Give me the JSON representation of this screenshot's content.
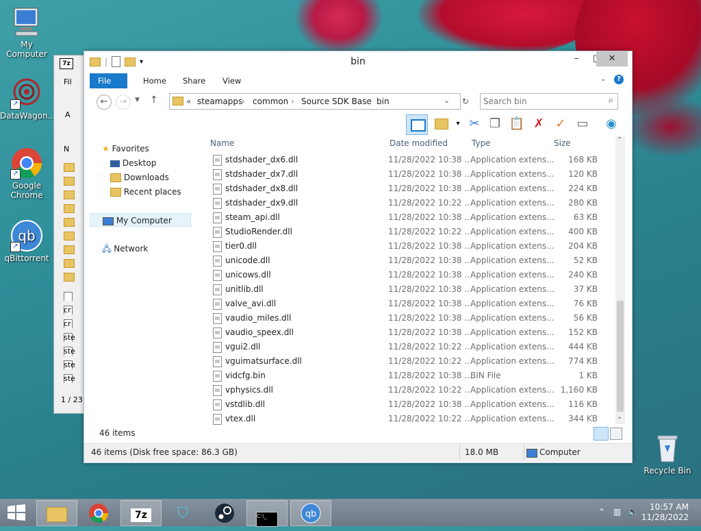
{
  "desktop": {
    "icons": [
      {
        "label": "My Computer"
      },
      {
        "label": "DataWagon..."
      },
      {
        "label": "Google Chrome"
      },
      {
        "label": "qBittorrent"
      },
      {
        "label": "Recycle Bin"
      }
    ]
  },
  "bg_window": {
    "labels": [
      "Fil",
      "A",
      "N"
    ],
    "rows": [
      "cr",
      "cr",
      "ste",
      "ste",
      "ste",
      "ste"
    ],
    "status": "1 / 23"
  },
  "explorer": {
    "title": "bin",
    "tabs": [
      "File",
      "Home",
      "Share",
      "View"
    ],
    "breadcrumb": {
      "overflow": "«",
      "parts": [
        "steamapps",
        "common",
        "Source SDK Base",
        "bin"
      ]
    },
    "search_placeholder": "Search bin",
    "nav": {
      "favorites": "Favorites",
      "fav_items": [
        "Desktop",
        "Downloads",
        "Recent places"
      ],
      "computer": "My Computer",
      "network": "Network"
    },
    "columns": {
      "name": "Name",
      "date": "Date modified",
      "type": "Type",
      "size": "Size"
    },
    "files": [
      {
        "name": "stdshader_dx6.dll",
        "date": "11/28/2022 10:38 ...",
        "type": "Application extens...",
        "size": "168 KB"
      },
      {
        "name": "stdshader_dx7.dll",
        "date": "11/28/2022 10:38 ...",
        "type": "Application extens...",
        "size": "120 KB"
      },
      {
        "name": "stdshader_dx8.dll",
        "date": "11/28/2022 10:38 ...",
        "type": "Application extens...",
        "size": "224 KB"
      },
      {
        "name": "stdshader_dx9.dll",
        "date": "11/28/2022 10:22 ...",
        "type": "Application extens...",
        "size": "280 KB"
      },
      {
        "name": "steam_api.dll",
        "date": "11/28/2022 10:38 ...",
        "type": "Application extens...",
        "size": "63 KB"
      },
      {
        "name": "StudioRender.dll",
        "date": "11/28/2022 10:22 ...",
        "type": "Application extens...",
        "size": "400 KB"
      },
      {
        "name": "tier0.dll",
        "date": "11/28/2022 10:38 ...",
        "type": "Application extens...",
        "size": "204 KB"
      },
      {
        "name": "unicode.dll",
        "date": "11/28/2022 10:38 ...",
        "type": "Application extens...",
        "size": "52 KB"
      },
      {
        "name": "unicows.dll",
        "date": "11/28/2022 10:38 ...",
        "type": "Application extens...",
        "size": "240 KB"
      },
      {
        "name": "unitlib.dll",
        "date": "11/28/2022 10:38 ...",
        "type": "Application extens...",
        "size": "37 KB"
      },
      {
        "name": "valve_avi.dll",
        "date": "11/28/2022 10:38 ...",
        "type": "Application extens...",
        "size": "76 KB"
      },
      {
        "name": "vaudio_miles.dll",
        "date": "11/28/2022 10:38 ...",
        "type": "Application extens...",
        "size": "56 KB"
      },
      {
        "name": "vaudio_speex.dll",
        "date": "11/28/2022 10:38 ...",
        "type": "Application extens...",
        "size": "152 KB"
      },
      {
        "name": "vgui2.dll",
        "date": "11/28/2022 10:22 ...",
        "type": "Application extens...",
        "size": "444 KB"
      },
      {
        "name": "vguimatsurface.dll",
        "date": "11/28/2022 10:22 ...",
        "type": "Application extens...",
        "size": "774 KB"
      },
      {
        "name": "vidcfg.bin",
        "date": "11/28/2022 10:38 ...",
        "type": "BIN File",
        "size": "1 KB"
      },
      {
        "name": "vphysics.dll",
        "date": "11/28/2022 10:22 ...",
        "type": "Application extens...",
        "size": "1,160 KB"
      },
      {
        "name": "vstdlib.dll",
        "date": "11/28/2022 10:38 ...",
        "type": "Application extens...",
        "size": "116 KB"
      },
      {
        "name": "vtex.dll",
        "date": "11/28/2022 10:22 ...",
        "type": "Application extens...",
        "size": "344 KB"
      }
    ],
    "item_count": "46 items",
    "status": {
      "left": "46 items (Disk free space: 86.3 GB)",
      "size": "18.0 MB",
      "location": "Computer"
    }
  },
  "taskbar": {
    "time": "10:57 AM",
    "date": "11/28/2022"
  },
  "colors": {
    "accent": "#1979ca",
    "taskbar": "#7b8794"
  }
}
